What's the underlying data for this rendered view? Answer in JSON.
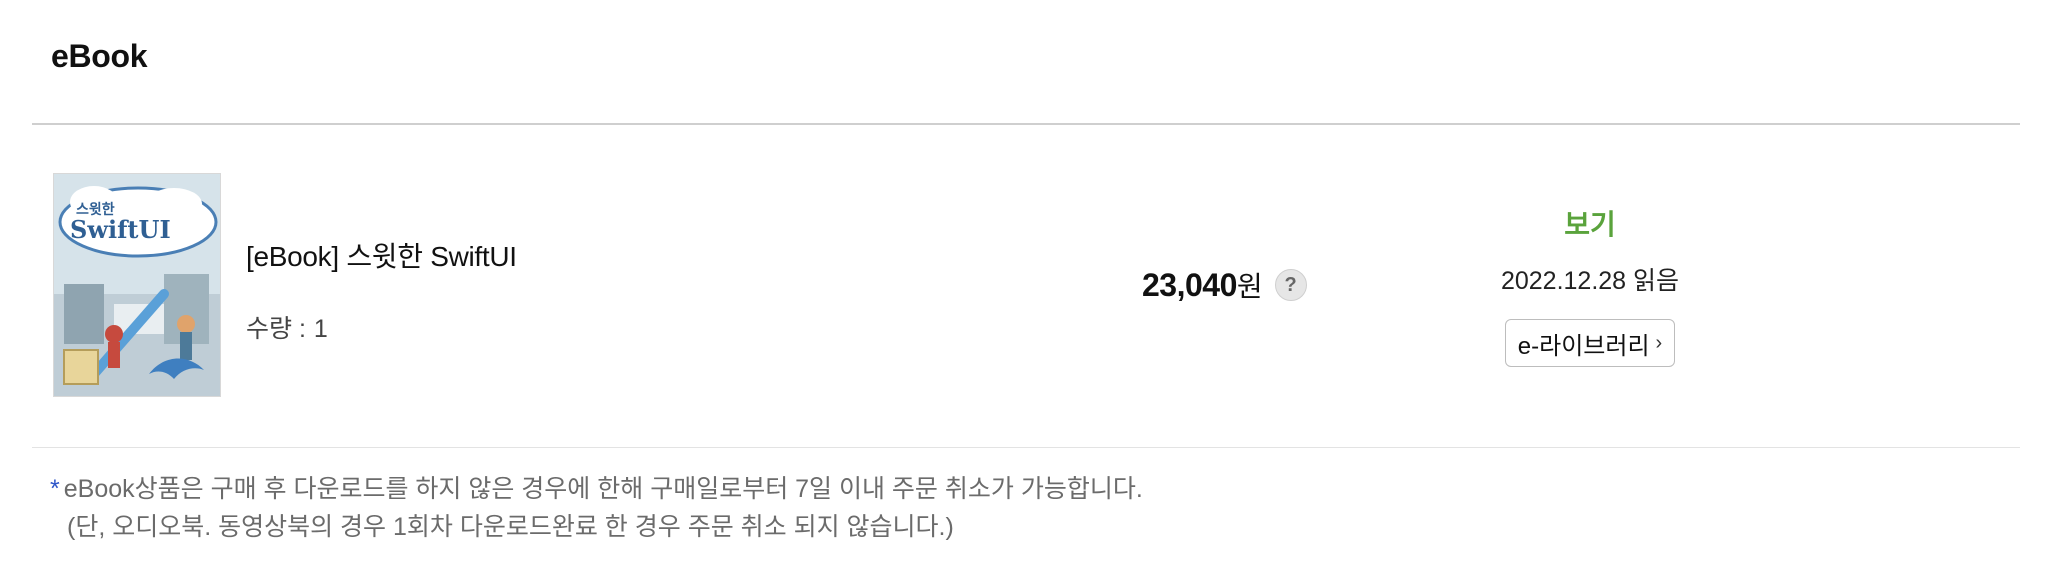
{
  "section": {
    "title": "eBook"
  },
  "item": {
    "title": "[eBook] 스윗한 SwiftUI",
    "quantity_label": "수량 :",
    "quantity_value": "1",
    "cover_alt": "스윗한 SwiftUI book cover",
    "cover_text_top": "스윗한",
    "cover_text_main": "SwiftUI"
  },
  "price": {
    "amount": "23,040",
    "unit": "원",
    "help_icon": "question-icon",
    "help_glyph": "?"
  },
  "status": {
    "view_label": "보기",
    "read_date": "2022.12.28 읽음",
    "elibrary_label": "e-라이브러리",
    "elibrary_chevron": "›"
  },
  "notice": {
    "star": "*",
    "line1": "eBook상품은 구매 후 다운로드를 하지 않은 경우에 한해 구매일로부터 7일 이내 주문 취소가 가능합니다.",
    "line2": "(단, 오디오북. 동영상북의 경우 1회차 다운로드완료 한 경우 주문 취소 되지 않습니다.)"
  },
  "colors": {
    "accent_green": "#5aa33c",
    "notice_star_blue": "#2e55c8",
    "divider": "#cfcfcf"
  }
}
